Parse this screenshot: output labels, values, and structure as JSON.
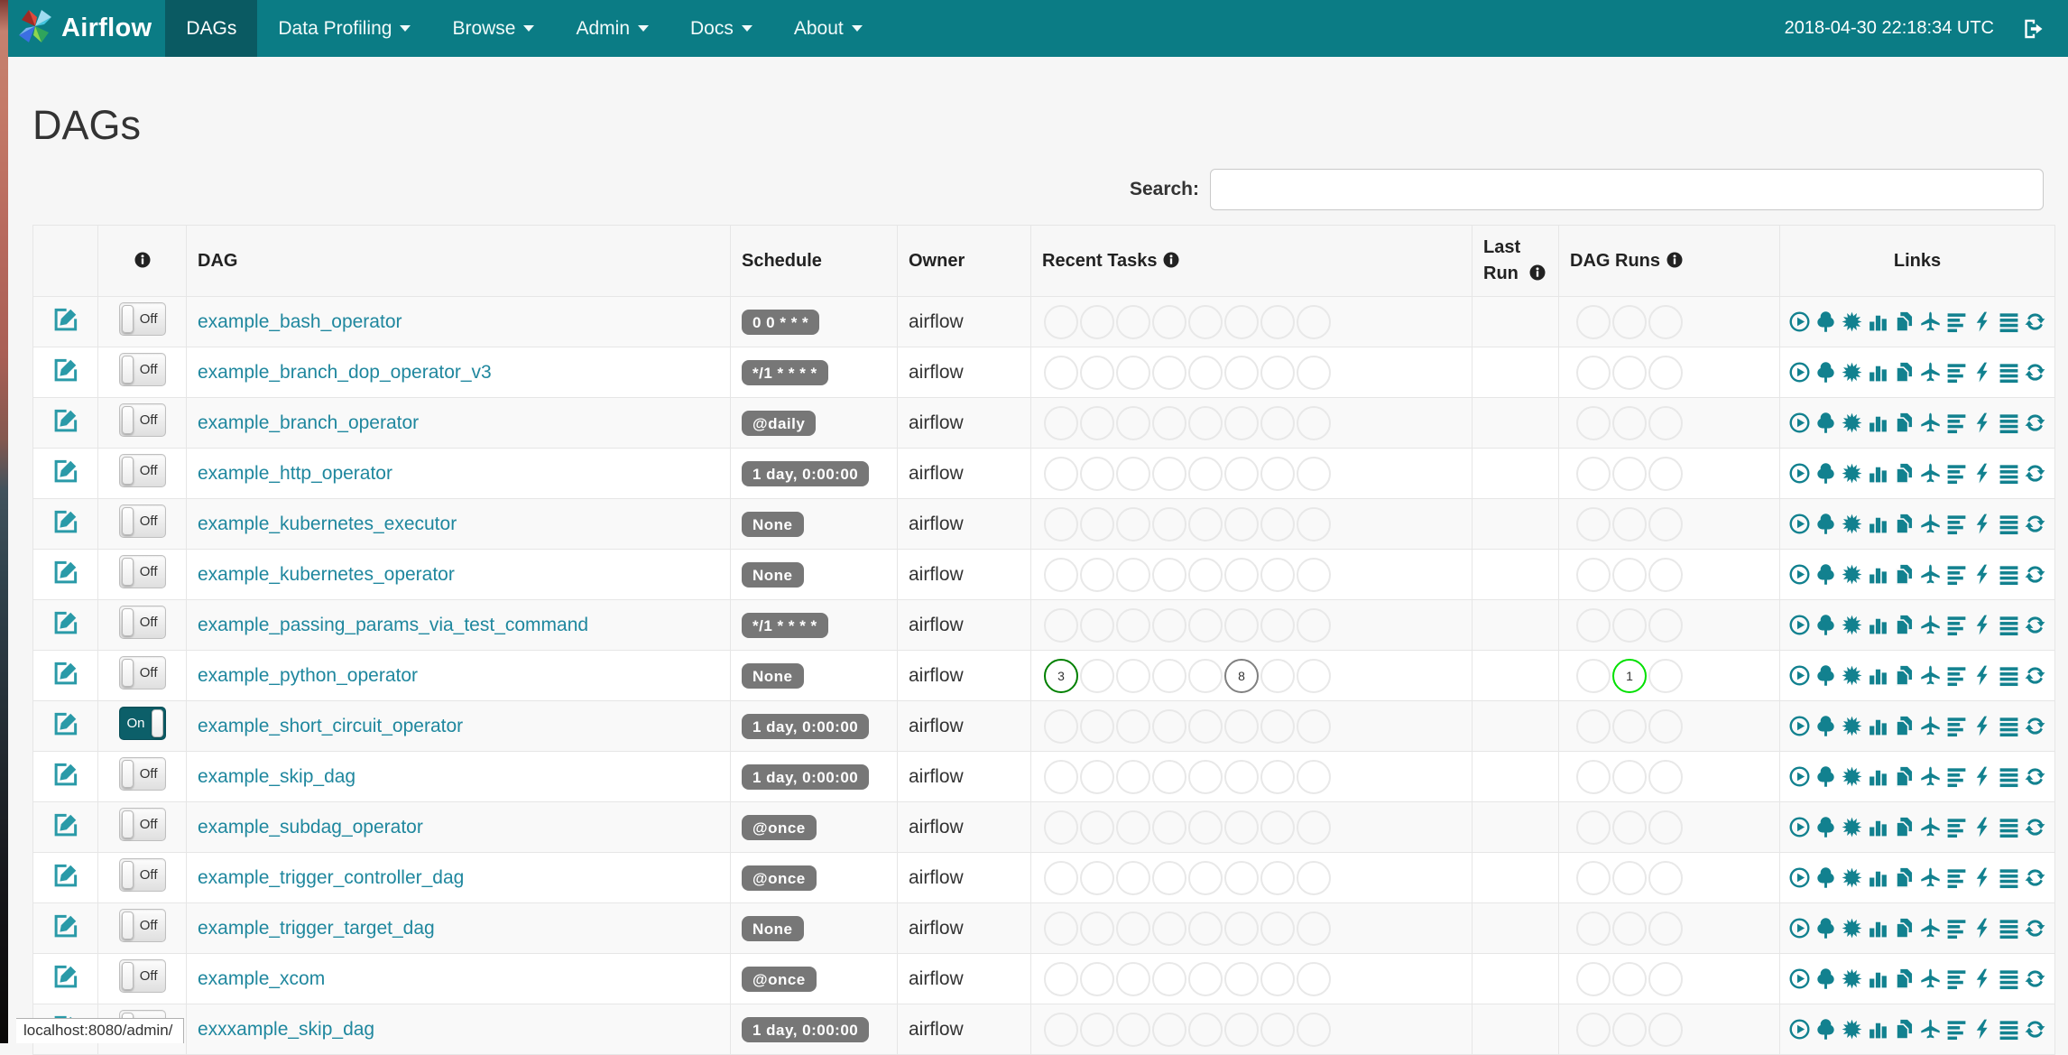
{
  "navbar": {
    "brand": "Airflow",
    "items": [
      {
        "label": "DAGs",
        "active": true,
        "caret": false
      },
      {
        "label": "Data Profiling",
        "active": false,
        "caret": true
      },
      {
        "label": "Browse",
        "active": false,
        "caret": true
      },
      {
        "label": "Admin",
        "active": false,
        "caret": true
      },
      {
        "label": "Docs",
        "active": false,
        "caret": true
      },
      {
        "label": "About",
        "active": false,
        "caret": true
      }
    ],
    "clock": "2018-04-30 22:18:34 UTC"
  },
  "page": {
    "title": "DAGs",
    "search_label": "Search:",
    "search_value": "",
    "status_bar": "localhost:8080/admin/"
  },
  "table": {
    "headers": {
      "edit": "",
      "info": "",
      "dag": "DAG",
      "schedule": "Schedule",
      "owner": "Owner",
      "recent_tasks": "Recent Tasks",
      "last_run": "Last Run",
      "dag_runs": "DAG Runs",
      "links": "Links"
    },
    "toggle_labels": {
      "on": "On",
      "off": "Off"
    },
    "recent_task_slots": 8,
    "dag_run_slots": 3,
    "links": [
      {
        "name": "trigger-dag",
        "icon": "play-circle"
      },
      {
        "name": "tree-view",
        "icon": "tree"
      },
      {
        "name": "graph-view",
        "icon": "sunburst"
      },
      {
        "name": "task-duration",
        "icon": "bar-chart"
      },
      {
        "name": "task-tries",
        "icon": "duplicate"
      },
      {
        "name": "landing-times",
        "icon": "plane"
      },
      {
        "name": "gantt",
        "icon": "align-left"
      },
      {
        "name": "code-view",
        "icon": "flash"
      },
      {
        "name": "logs",
        "icon": "align-justify"
      },
      {
        "name": "refresh",
        "icon": "refresh"
      }
    ],
    "rows": [
      {
        "dag": "example_bash_operator",
        "schedule": "0 0 * * *",
        "owner": "airflow",
        "toggle": "off",
        "recent_tasks": [],
        "dag_runs": []
      },
      {
        "dag": "example_branch_dop_operator_v3",
        "schedule": "*/1 * * * *",
        "owner": "airflow",
        "toggle": "off",
        "recent_tasks": [],
        "dag_runs": []
      },
      {
        "dag": "example_branch_operator",
        "schedule": "@daily",
        "owner": "airflow",
        "toggle": "off",
        "recent_tasks": [],
        "dag_runs": []
      },
      {
        "dag": "example_http_operator",
        "schedule": "1 day, 0:00:00",
        "owner": "airflow",
        "toggle": "off",
        "recent_tasks": [],
        "dag_runs": []
      },
      {
        "dag": "example_kubernetes_executor",
        "schedule": "None",
        "owner": "airflow",
        "toggle": "off",
        "recent_tasks": [],
        "dag_runs": []
      },
      {
        "dag": "example_kubernetes_operator",
        "schedule": "None",
        "owner": "airflow",
        "toggle": "off",
        "recent_tasks": [],
        "dag_runs": []
      },
      {
        "dag": "example_passing_params_via_test_command",
        "schedule": "*/1 * * * *",
        "owner": "airflow",
        "toggle": "off",
        "recent_tasks": [],
        "dag_runs": []
      },
      {
        "dag": "example_python_operator",
        "schedule": "None",
        "owner": "airflow",
        "toggle": "off",
        "recent_tasks": [
          {
            "slot": 0,
            "count": 3,
            "state": "success"
          },
          {
            "slot": 5,
            "count": 8,
            "state": "queued"
          }
        ],
        "dag_runs": [
          {
            "slot": 1,
            "count": 1,
            "state": "running"
          }
        ]
      },
      {
        "dag": "example_short_circuit_operator",
        "schedule": "1 day, 0:00:00",
        "owner": "airflow",
        "toggle": "on",
        "recent_tasks": [],
        "dag_runs": []
      },
      {
        "dag": "example_skip_dag",
        "schedule": "1 day, 0:00:00",
        "owner": "airflow",
        "toggle": "off",
        "recent_tasks": [],
        "dag_runs": []
      },
      {
        "dag": "example_subdag_operator",
        "schedule": "@once",
        "owner": "airflow",
        "toggle": "off",
        "recent_tasks": [],
        "dag_runs": []
      },
      {
        "dag": "example_trigger_controller_dag",
        "schedule": "@once",
        "owner": "airflow",
        "toggle": "off",
        "recent_tasks": [],
        "dag_runs": []
      },
      {
        "dag": "example_trigger_target_dag",
        "schedule": "None",
        "owner": "airflow",
        "toggle": "off",
        "recent_tasks": [],
        "dag_runs": []
      },
      {
        "dag": "example_xcom",
        "schedule": "@once",
        "owner": "airflow",
        "toggle": "off",
        "recent_tasks": [],
        "dag_runs": []
      },
      {
        "dag": "exxxample_skip_dag",
        "schedule": "1 day, 0:00:00",
        "owner": "airflow",
        "toggle": "off",
        "recent_tasks": [],
        "dag_runs": []
      }
    ]
  },
  "colors": {
    "navbar": "#0b7c85",
    "navbar_active": "#0a5a62",
    "link": "#1f879e",
    "icon": "#12818f",
    "badge_bg": "#777777",
    "circle_empty": "#e8e8e8",
    "success": "#008000",
    "queued": "#808080",
    "running": "#00e000"
  }
}
